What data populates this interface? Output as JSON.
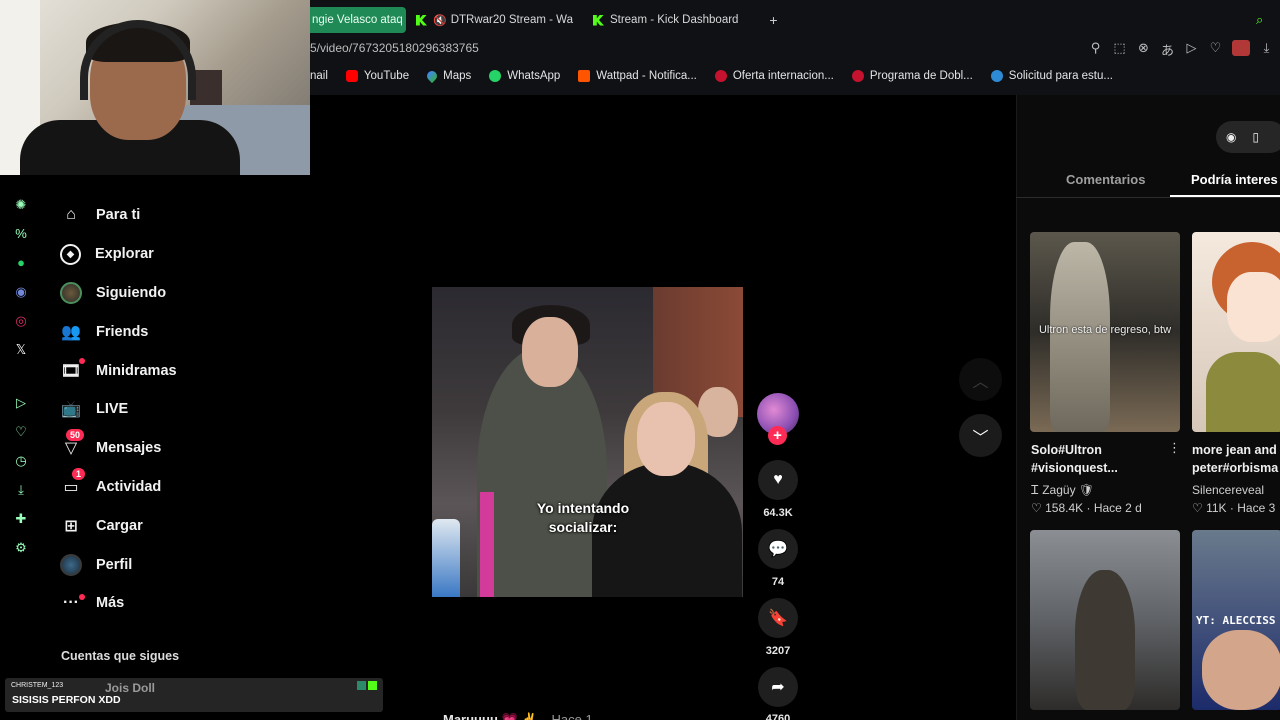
{
  "browser": {
    "tabs": [
      {
        "label": "ngie Velasco ataq",
        "active": true
      },
      {
        "label": "DTRwar20 Stream - Wa",
        "active": false,
        "muted": true
      },
      {
        "label": "Stream - Kick Dashboard",
        "active": false
      }
    ],
    "url": "5/video/7673205180296383765",
    "bookmarks": [
      "nail",
      "YouTube",
      "Maps",
      "WhatsApp",
      "Wattpad - Notifica...",
      "Oferta internacion...",
      "Programa de Dobl...",
      "Solicitud para estu..."
    ]
  },
  "sidebar": {
    "items": [
      {
        "label": "Para ti",
        "icon": "home-icon"
      },
      {
        "label": "Explorar",
        "icon": "compass-icon"
      },
      {
        "label": "Siguiendo",
        "icon": "following-avatar-icon"
      },
      {
        "label": "Friends",
        "icon": "friends-icon"
      },
      {
        "label": "Minidramas",
        "icon": "film-icon"
      },
      {
        "label": "LIVE",
        "icon": "live-tv-icon"
      },
      {
        "label": "Mensajes",
        "icon": "send-icon",
        "badge": "50"
      },
      {
        "label": "Actividad",
        "icon": "inbox-icon",
        "badge": "1"
      },
      {
        "label": "Cargar",
        "icon": "plus-square-icon"
      },
      {
        "label": "Perfil",
        "icon": "profile-avatar-icon"
      },
      {
        "label": "Más",
        "icon": "more-icon"
      }
    ],
    "following_title": "Cuentas que sigues"
  },
  "chat_overlay": {
    "username": "CHRISTEM_123",
    "message": "SISISIS PERFON XDD",
    "follow_name": "Jois Doll"
  },
  "video": {
    "caption": "Yo intentando\nsocializar:",
    "likes": "64.3K",
    "comments": "74",
    "saves": "3207",
    "shares": "4760",
    "bottom_author": "Maruuuu 💗 ✌️",
    "bottom_time": "Hace 1"
  },
  "right_panel": {
    "tabs": {
      "comments": "Comentarios",
      "related": "Podría interes"
    },
    "cards": [
      {
        "thumb_text": "Ultron esta de regreso, btw",
        "title": "Solo#Ultron\n#visionquest...",
        "author": "Ꮖ Zagüy 🛡",
        "likes": "158.4K",
        "time": "Hace 2 d"
      },
      {
        "title": "more jean and\npeter#orbisma",
        "author": "Silencereveal",
        "likes": "11K",
        "time": "Hace 3"
      },
      {
        "title": "",
        "author": "",
        "likes": "",
        "time": ""
      },
      {
        "thumb_text": "YT: ALECCISS",
        "title": "",
        "author": "",
        "likes": "",
        "time": ""
      }
    ]
  }
}
